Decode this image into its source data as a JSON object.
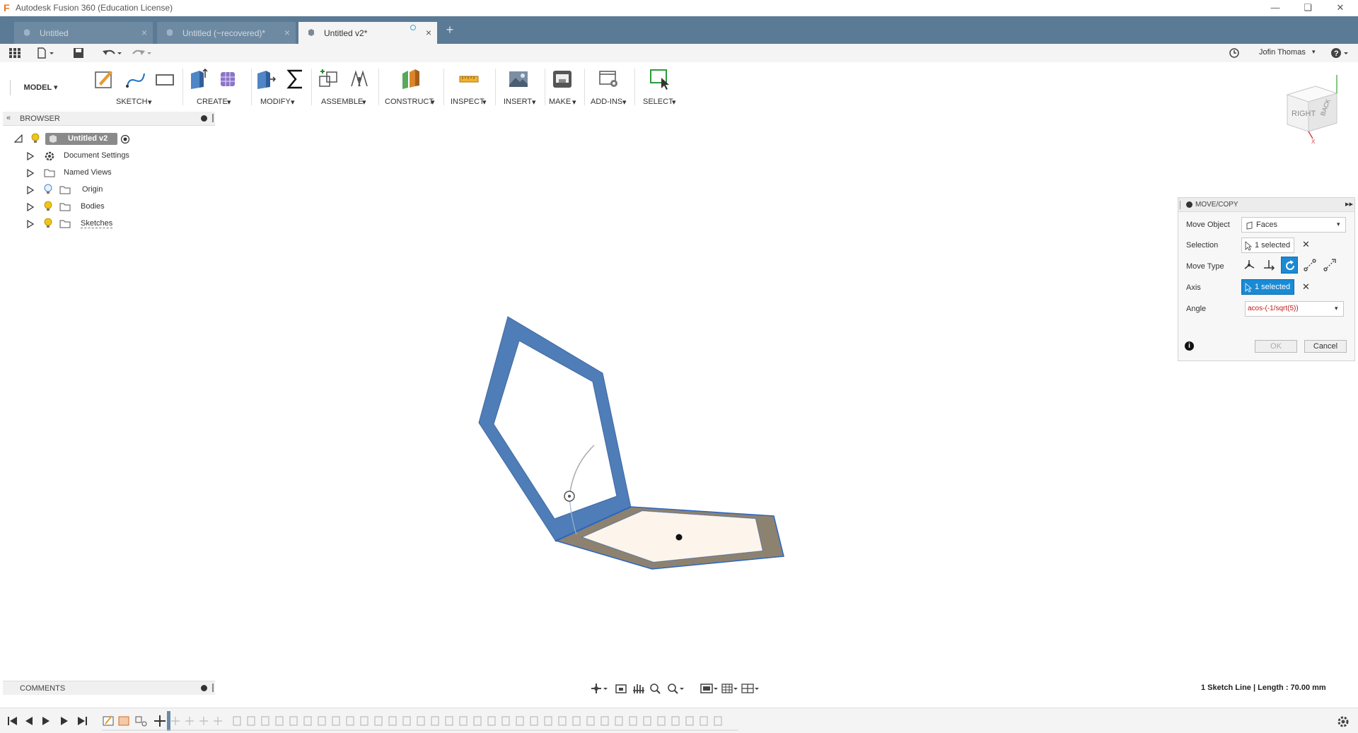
{
  "window": {
    "title": "Autodesk Fusion 360 (Education License)",
    "controls": [
      "minimize",
      "restore",
      "close"
    ]
  },
  "tabs": [
    {
      "label": "Untitled",
      "active": false
    },
    {
      "label": "Untitled (~recovered)*",
      "active": false
    },
    {
      "label": "Untitled v2*",
      "active": true
    }
  ],
  "quickbar": {
    "user": "Jofin Thomas",
    "icons": [
      "app-grid-icon",
      "file-icon",
      "save-icon",
      "undo-icon",
      "redo-icon",
      "clock-icon",
      "help-icon"
    ]
  },
  "toolbar": {
    "workspace": "MODEL",
    "groups": [
      {
        "label": "SKETCH"
      },
      {
        "label": "CREATE"
      },
      {
        "label": "MODIFY"
      },
      {
        "label": "ASSEMBLE"
      },
      {
        "label": "CONSTRUCT"
      },
      {
        "label": "INSPECT"
      },
      {
        "label": "INSERT"
      },
      {
        "label": "MAKE"
      },
      {
        "label": "ADD-INS"
      },
      {
        "label": "SELECT"
      }
    ]
  },
  "viewcube": {
    "right": "RIGHT",
    "back": "BACK"
  },
  "browser": {
    "title": "BROWSER",
    "root": "Untitled v2",
    "items": [
      {
        "label": "Document Settings",
        "icon": "gear-icon"
      },
      {
        "label": "Named Views",
        "icon": "folder-icon"
      },
      {
        "label": "Origin",
        "icon": "folder-icon"
      },
      {
        "label": "Bodies",
        "icon": "folder-icon"
      },
      {
        "label": "Sketches",
        "icon": "folder-icon"
      }
    ]
  },
  "movecopy": {
    "title": "MOVE/COPY",
    "move_object_label": "Move Object",
    "move_object_value": "Faces",
    "selection_label": "Selection",
    "selection_value": "1 selected",
    "move_type_label": "Move Type",
    "axis_label": "Axis",
    "axis_value": "1 selected",
    "angle_label": "Angle",
    "angle_value": "acos-(-1/sqrt(5))",
    "ok": "OK",
    "cancel": "Cancel"
  },
  "comments": {
    "title": "COMMENTS"
  },
  "status": {
    "text": "1 Sketch Line | Length : 70.00 mm"
  },
  "colors": {
    "tabbar": "#5b7a96",
    "face_blue": "#4f7db8",
    "face_brown": "#8d8270",
    "face_selected": "#fdf5ec",
    "accent": "#0b8fd6"
  }
}
